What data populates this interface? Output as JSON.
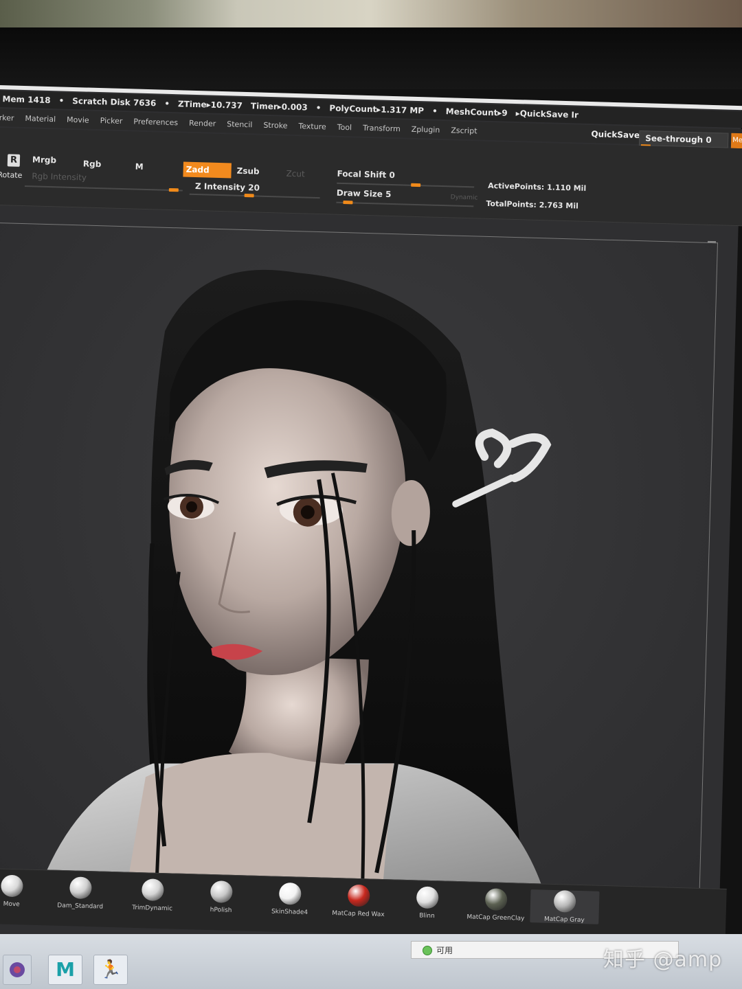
{
  "status_bar": {
    "mem": "Mem 1418",
    "scratch": "Scratch Disk 7636",
    "ztime": "ZTime▸10.737",
    "timer": "Timer▸0.003",
    "polycount": "PolyCount▸1.317 MP",
    "meshcount": "MeshCount▸9"
  },
  "menu": {
    "items": [
      "rker",
      "Material",
      "Movie",
      "Picker",
      "Preferences",
      "Render",
      "Stencil",
      "Stroke",
      "Texture",
      "Tool",
      "Transform",
      "Zplugin",
      "Zscript"
    ],
    "quicksave_ir": "▸QuickSave Ir",
    "quicksave": "QuickSave",
    "see_through": "See-through  0",
    "me_tab": "Me"
  },
  "tool_shelf": {
    "rotate": "Rotate",
    "r_icon": "R",
    "mrgb": "Mrgb",
    "rgb": "Rgb",
    "m": "M",
    "rgb_intensity": "Rgb Intensity",
    "zadd": "Zadd",
    "zsub": "Zsub",
    "zcut": "Zcut",
    "z_intensity": "Z Intensity 20",
    "focal_shift": "Focal Shift 0",
    "draw_size": "Draw Size 5",
    "dynamic": "Dynamic",
    "active_points": "ActivePoints: 1.110 Mil",
    "total_points": "TotalPoints: 2.763 Mil"
  },
  "materials": [
    {
      "label": "Move",
      "color": "#d8d8d8"
    },
    {
      "label": "Dam_Standard",
      "color": "#cfcfcf"
    },
    {
      "label": "TrimDynamic",
      "color": "#d4d4d4"
    },
    {
      "label": "hPolish",
      "color": "#c8c8c8"
    },
    {
      "label": "SkinShade4",
      "color": "#f2f2f2"
    },
    {
      "label": "MatCap Red Wax",
      "color": "#c8281e"
    },
    {
      "label": "Blinn",
      "color": "#e0e0e0"
    },
    {
      "label": "MatCap GreenClay",
      "color": "#5c6152"
    },
    {
      "label": "MatCap Gray",
      "color": "#b8b8b8"
    }
  ],
  "taskbar": {
    "available": "可用",
    "maya_icon": "M"
  },
  "watermark": "知乎 @amp"
}
